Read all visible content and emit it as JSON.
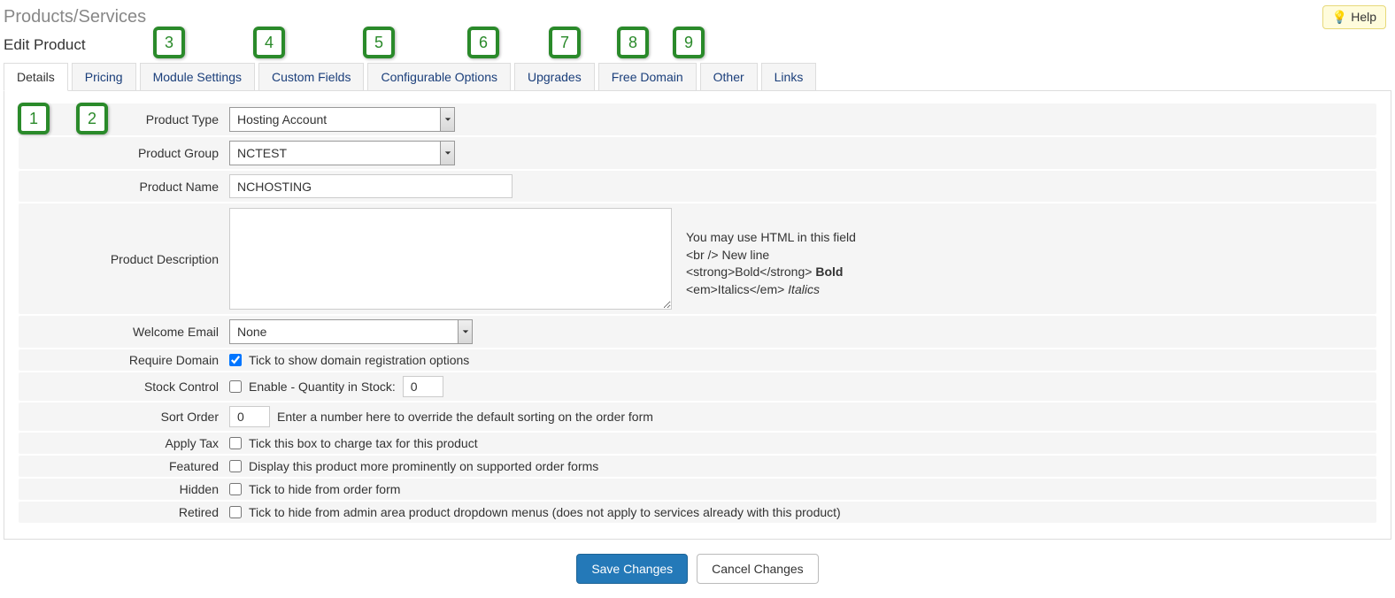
{
  "header": {
    "page_title": "Products/Services",
    "sub_title": "Edit Product",
    "help_label": "Help"
  },
  "tabs": {
    "details": "Details",
    "pricing": "Pricing",
    "module_settings": "Module Settings",
    "custom_fields": "Custom Fields",
    "config_options": "Configurable Options",
    "upgrades": "Upgrades",
    "free_domain": "Free Domain",
    "other": "Other",
    "links": "Links"
  },
  "form": {
    "product_type": {
      "label": "Product Type",
      "value": "Hosting Account"
    },
    "product_group": {
      "label": "Product Group",
      "value": "NCTEST"
    },
    "product_name": {
      "label": "Product Name",
      "value": "NCHOSTING"
    },
    "product_desc": {
      "label": "Product Description",
      "value": "",
      "hint_html_msg": "You may use HTML in this field",
      "hint_br_code": "<br />",
      "hint_br_text": "New line",
      "hint_strong_code": "<strong>Bold</strong>",
      "hint_strong_text": "Bold",
      "hint_em_code": "<em>Italics</em>",
      "hint_em_text": "Italics"
    },
    "welcome_email": {
      "label": "Welcome Email",
      "value": "None"
    },
    "require_domain": {
      "label": "Require Domain",
      "text": "Tick to show domain registration options",
      "checked": true
    },
    "stock": {
      "label": "Stock Control",
      "text": "Enable - Quantity in Stock:",
      "checked": false,
      "qty": "0"
    },
    "sort_order": {
      "label": "Sort Order",
      "value": "0",
      "hint": "Enter a number here to override the default sorting on the order form"
    },
    "apply_tax": {
      "label": "Apply Tax",
      "text": "Tick this box to charge tax for this product",
      "checked": false
    },
    "featured": {
      "label": "Featured",
      "text": "Display this product more prominently on supported order forms",
      "checked": false
    },
    "hidden": {
      "label": "Hidden",
      "text": "Tick to hide from order form",
      "checked": false
    },
    "retired": {
      "label": "Retired",
      "text": "Tick to hide from admin area product dropdown menus (does not apply to services already with this product)",
      "checked": false
    }
  },
  "buttons": {
    "save": "Save Changes",
    "cancel": "Cancel Changes"
  },
  "callouts": {
    "c1": "1",
    "c2": "2",
    "c3": "3",
    "c4": "4",
    "c5": "5",
    "c6": "6",
    "c7": "7",
    "c8": "8",
    "c9": "9"
  }
}
